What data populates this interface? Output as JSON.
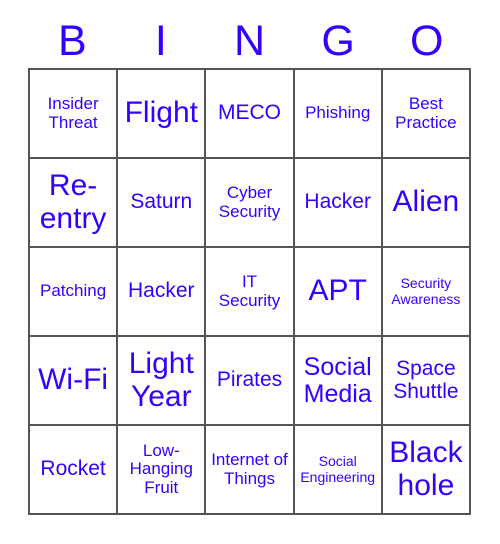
{
  "card": {
    "title_letters": [
      "B",
      "I",
      "N",
      "G",
      "O"
    ],
    "accent_color": "#3300ff",
    "border_color": "#555555",
    "background_color": "#ffffff",
    "rows": [
      [
        {
          "label": "Insider Threat",
          "size": "sm"
        },
        {
          "label": "Flight",
          "size": "xl"
        },
        {
          "label": "MECO",
          "size": "md"
        },
        {
          "label": "Phishing",
          "size": "sm"
        },
        {
          "label": "Best Practice",
          "size": "sm"
        }
      ],
      [
        {
          "label": "Re-entry",
          "size": "xl"
        },
        {
          "label": "Saturn",
          "size": "md"
        },
        {
          "label": "Cyber Security",
          "size": "sm"
        },
        {
          "label": "Hacker",
          "size": "md"
        },
        {
          "label": "Alien",
          "size": "xl"
        }
      ],
      [
        {
          "label": "Patching",
          "size": "sm"
        },
        {
          "label": "Hacker",
          "size": "md"
        },
        {
          "label": "IT Security",
          "size": "sm"
        },
        {
          "label": "APT",
          "size": "xl"
        },
        {
          "label": "Security Awareness",
          "size": "xs"
        }
      ],
      [
        {
          "label": "Wi-Fi",
          "size": "xl"
        },
        {
          "label": "Light Year",
          "size": "xl"
        },
        {
          "label": "Pirates",
          "size": "md"
        },
        {
          "label": "Social Media",
          "size": "lg"
        },
        {
          "label": "Space Shuttle",
          "size": "md"
        }
      ],
      [
        {
          "label": "Rocket",
          "size": "md"
        },
        {
          "label": "Low-Hanging Fruit",
          "size": "sm"
        },
        {
          "label": "Internet of Things",
          "size": "sm"
        },
        {
          "label": "Social Engineering",
          "size": "xs"
        },
        {
          "label": "Black hole",
          "size": "xl"
        }
      ]
    ]
  }
}
